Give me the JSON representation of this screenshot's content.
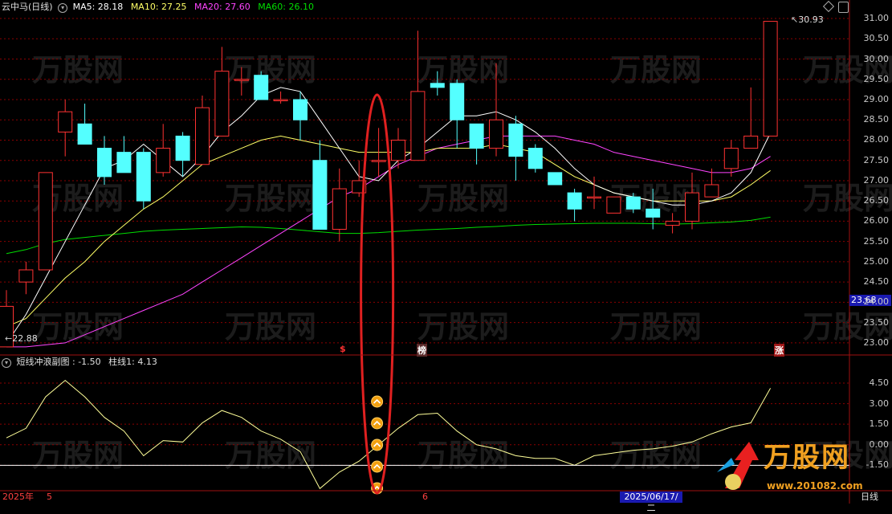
{
  "main_header": {
    "stock_name": "云中马(日线)",
    "ma5_label": "MA5: 28.18",
    "ma10_label": "MA10: 27.25",
    "ma20_label": "MA20: 27.60",
    "ma60_label": "MA60: 26.10"
  },
  "sub_header": {
    "title": "短线冲浪副图",
    "value_text": ": -1.50",
    "bar_text": "柱线1: 4.13"
  },
  "annotations": {
    "high_label": "30.93",
    "low_label": "22.88",
    "current_price": "23.68",
    "marker_s": "$",
    "marker_bang": "榜",
    "marker_zhang": "涨"
  },
  "bottom_axis": {
    "year_label": "2025年",
    "month5": "5",
    "month6": "6",
    "cursor_date": "2025/06/17/二",
    "period": "日线"
  },
  "watermark": {
    "logo_text": "万股网",
    "url": "www.201082.com"
  },
  "colors": {
    "up": "#ff3232",
    "down": "#54ffff",
    "ma5": "#ffffff",
    "ma10": "#ffff66",
    "ma20": "#ff44ff",
    "ma60": "#00dd00",
    "grid": "#8b0000"
  },
  "chart_data": [
    {
      "type": "candlestick",
      "title": "云中马(日线)",
      "y_ticks": [
        "31.00",
        "30.50",
        "30.00",
        "29.50",
        "29.00",
        "28.50",
        "28.00",
        "27.50",
        "27.00",
        "26.50",
        "26.00",
        "25.50",
        "25.00",
        "24.50",
        "24.00",
        "23.50",
        "23.00"
      ],
      "ylim": [
        22.7,
        31.1
      ],
      "candles": [
        {
          "o": 22.9,
          "c": 23.9,
          "h": 24.3,
          "l": 22.9
        },
        {
          "o": 24.5,
          "c": 24.8,
          "h": 25.0,
          "l": 24.2
        },
        {
          "o": 24.8,
          "c": 27.2,
          "h": 27.2,
          "l": 24.8
        },
        {
          "o": 28.2,
          "c": 28.7,
          "h": 29.0,
          "l": 27.6
        },
        {
          "o": 28.4,
          "c": 27.9,
          "h": 28.9,
          "l": 27.9
        },
        {
          "o": 27.8,
          "c": 27.1,
          "h": 28.1,
          "l": 26.9
        },
        {
          "o": 27.7,
          "c": 27.2,
          "h": 28.1,
          "l": 27.2
        },
        {
          "o": 27.7,
          "c": 26.5,
          "h": 27.8,
          "l": 26.3
        },
        {
          "o": 27.2,
          "c": 27.8,
          "h": 28.4,
          "l": 27.1
        },
        {
          "o": 28.1,
          "c": 27.5,
          "h": 28.2,
          "l": 27.1
        },
        {
          "o": 27.4,
          "c": 28.8,
          "h": 29.1,
          "l": 27.4
        },
        {
          "o": 28.1,
          "c": 29.7,
          "h": 30.3,
          "l": 28.1
        },
        {
          "o": 29.5,
          "c": 29.5,
          "h": 29.8,
          "l": 29.1
        },
        {
          "o": 29.6,
          "c": 29.0,
          "h": 29.7,
          "l": 29.0
        },
        {
          "o": 29.0,
          "c": 29.0,
          "h": 29.2,
          "l": 28.9
        },
        {
          "o": 29.0,
          "c": 28.5,
          "h": 29.2,
          "l": 28.0
        },
        {
          "o": 27.5,
          "c": 25.8,
          "h": 28.0,
          "l": 25.8
        },
        {
          "o": 25.8,
          "c": 26.8,
          "h": 27.3,
          "l": 25.5
        },
        {
          "o": 26.7,
          "c": 27.0,
          "h": 27.5,
          "l": 26.6
        },
        {
          "o": 27.5,
          "c": 27.5,
          "h": 28.3,
          "l": 27.1
        },
        {
          "o": 27.5,
          "c": 28.0,
          "h": 28.3,
          "l": 27.3
        },
        {
          "o": 27.5,
          "c": 29.2,
          "h": 30.7,
          "l": 27.5
        },
        {
          "o": 29.4,
          "c": 29.3,
          "h": 29.7,
          "l": 29.1
        },
        {
          "o": 29.4,
          "c": 28.5,
          "h": 29.5,
          "l": 27.8
        },
        {
          "o": 28.4,
          "c": 27.8,
          "h": 28.4,
          "l": 27.4
        },
        {
          "o": 27.8,
          "c": 28.5,
          "h": 29.9,
          "l": 27.6
        },
        {
          "o": 28.4,
          "c": 27.6,
          "h": 28.6,
          "l": 27.0
        },
        {
          "o": 27.8,
          "c": 27.3,
          "h": 27.9,
          "l": 27.2
        },
        {
          "o": 27.2,
          "c": 26.9,
          "h": 27.2,
          "l": 26.9
        },
        {
          "o": 26.7,
          "c": 26.3,
          "h": 26.8,
          "l": 26.0
        },
        {
          "o": 26.6,
          "c": 26.6,
          "h": 27.1,
          "l": 26.3
        },
        {
          "o": 26.2,
          "c": 26.6,
          "h": 26.6,
          "l": 26.2
        },
        {
          "o": 26.6,
          "c": 26.3,
          "h": 26.7,
          "l": 26.2
        },
        {
          "o": 26.3,
          "c": 26.1,
          "h": 26.8,
          "l": 25.8
        },
        {
          "o": 25.9,
          "c": 26.0,
          "h": 26.2,
          "l": 25.7
        },
        {
          "o": 26.0,
          "c": 26.7,
          "h": 27.2,
          "l": 25.8
        },
        {
          "o": 26.6,
          "c": 26.9,
          "h": 27.3,
          "l": 26.6
        },
        {
          "o": 27.3,
          "c": 27.8,
          "h": 28.0,
          "l": 27.1
        },
        {
          "o": 27.8,
          "c": 28.1,
          "h": 29.3,
          "l": 27.8
        },
        {
          "o": 28.1,
          "c": 30.93,
          "h": 30.93,
          "l": 28.1
        }
      ],
      "ma5": [
        22.98,
        23.7,
        24.6,
        25.5,
        26.4,
        27.3,
        27.5,
        27.9,
        27.5,
        27.1,
        27.6,
        28.2,
        28.6,
        29.1,
        29.3,
        29.2,
        28.5,
        27.8,
        27.1,
        27.0,
        27.5,
        27.8,
        28.2,
        28.6,
        28.6,
        28.7,
        28.5,
        28.2,
        27.8,
        27.3,
        26.9,
        26.7,
        26.6,
        26.5,
        26.4,
        26.4,
        26.5,
        26.7,
        27.2,
        28.18
      ],
      "ma10": [
        23.4,
        23.6,
        24.1,
        24.6,
        25.0,
        25.5,
        25.9,
        26.3,
        26.6,
        27.0,
        27.4,
        27.6,
        27.8,
        28.0,
        28.1,
        28.0,
        27.9,
        27.8,
        27.7,
        27.7,
        27.7,
        27.7,
        27.8,
        27.8,
        27.8,
        27.9,
        27.8,
        27.7,
        27.4,
        27.1,
        26.9,
        26.7,
        26.6,
        26.5,
        26.5,
        26.5,
        26.5,
        26.6,
        26.9,
        27.25
      ],
      "ma20": [
        22.9,
        22.9,
        22.95,
        23.0,
        23.2,
        23.4,
        23.6,
        23.8,
        24.0,
        24.2,
        24.5,
        24.8,
        25.1,
        25.4,
        25.7,
        26.0,
        26.3,
        26.6,
        26.8,
        27.1,
        27.4,
        27.6,
        27.8,
        27.9,
        28.0,
        28.1,
        28.1,
        28.1,
        28.1,
        28.0,
        27.9,
        27.7,
        27.6,
        27.5,
        27.4,
        27.3,
        27.2,
        27.2,
        27.3,
        27.6
      ],
      "ma60": [
        25.2,
        25.3,
        25.45,
        25.55,
        25.6,
        25.65,
        25.7,
        25.75,
        25.78,
        25.8,
        25.82,
        25.84,
        25.86,
        25.85,
        25.82,
        25.78,
        25.74,
        25.7,
        25.7,
        25.72,
        25.75,
        25.78,
        25.8,
        25.82,
        25.85,
        25.87,
        25.9,
        25.92,
        25.93,
        25.94,
        25.95,
        25.95,
        25.95,
        25.94,
        25.93,
        25.94,
        25.96,
        25.98,
        26.02,
        26.1
      ]
    },
    {
      "type": "line",
      "title": "短线冲浪副图",
      "y_ticks": [
        "4.50",
        "3.00",
        "1.50",
        "0.00",
        "-1.50"
      ],
      "ylim": [
        -3.3,
        5.5
      ],
      "reference_value": -1.5,
      "values": [
        0.5,
        1.2,
        3.5,
        4.7,
        3.5,
        2.0,
        1.0,
        -0.8,
        0.3,
        0.2,
        1.6,
        2.5,
        2.0,
        1.0,
        0.4,
        -0.5,
        -3.2,
        -2.0,
        -1.2,
        0.0,
        1.2,
        2.2,
        2.3,
        1.0,
        0.0,
        -0.3,
        -0.8,
        -1.0,
        -1.0,
        -1.5,
        -0.8,
        -0.6,
        -0.4,
        -0.3,
        -0.1,
        0.2,
        0.8,
        1.3,
        1.6,
        4.13
      ],
      "signal_count": 5
    }
  ]
}
